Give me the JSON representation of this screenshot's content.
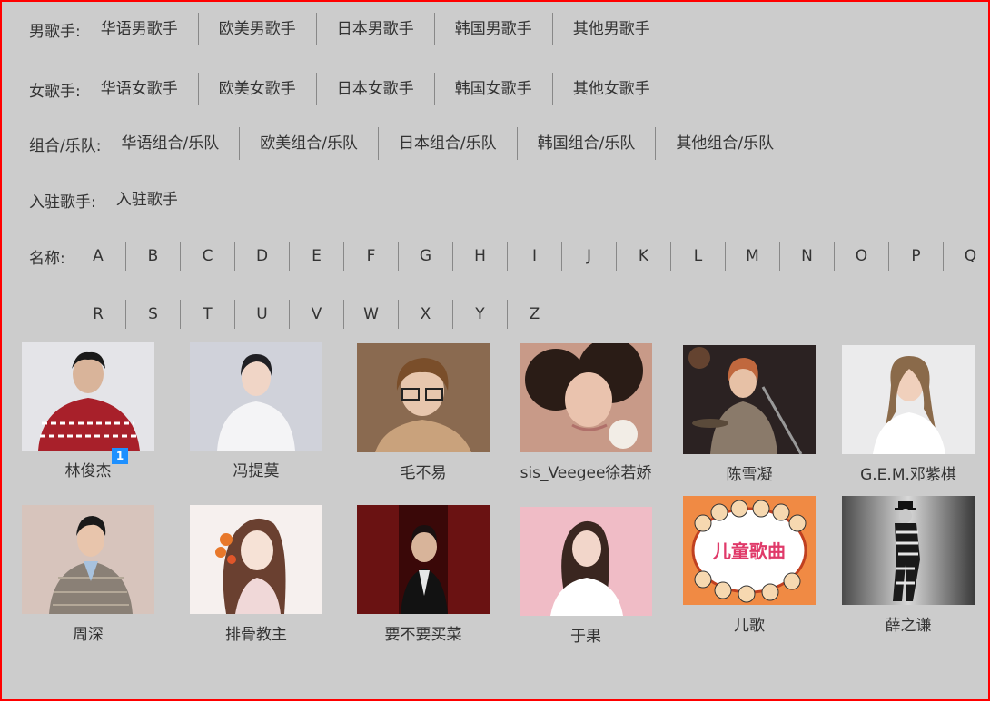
{
  "categories": [
    {
      "label": "男歌手:",
      "items": [
        "华语男歌手",
        "欧美男歌手",
        "日本男歌手",
        "韩国男歌手",
        "其他男歌手"
      ]
    },
    {
      "label": "女歌手:",
      "items": [
        "华语女歌手",
        "欧美女歌手",
        "日本女歌手",
        "韩国女歌手",
        "其他女歌手"
      ]
    },
    {
      "label": "组合/乐队:",
      "items": [
        "华语组合/乐队",
        "欧美组合/乐队",
        "日本组合/乐队",
        "韩国组合/乐队",
        "其他组合/乐队"
      ]
    },
    {
      "label": "入驻歌手:",
      "items": [
        "入驻歌手"
      ]
    }
  ],
  "letters_label": "名称:",
  "letters_row1": [
    "A",
    "B",
    "C",
    "D",
    "E",
    "F",
    "G",
    "H",
    "I",
    "J",
    "K",
    "L",
    "M",
    "N",
    "O",
    "P",
    "Q"
  ],
  "letters_row2": [
    "R",
    "S",
    "T",
    "U",
    "V",
    "W",
    "X",
    "Y",
    "Z"
  ],
  "artists": [
    {
      "name": "林俊杰",
      "badge": "1"
    },
    {
      "name": "冯提莫"
    },
    {
      "name": "毛不易"
    },
    {
      "name": "sis_Veegee徐若娇"
    },
    {
      "name": "陈雪凝"
    },
    {
      "name": "G.E.M.邓紫棋"
    },
    {
      "name": "周深"
    },
    {
      "name": "排骨教主"
    },
    {
      "name": "要不要买菜"
    },
    {
      "name": "于果"
    },
    {
      "name": "儿歌",
      "photo_text": "儿童歌曲"
    },
    {
      "name": "薛之谦"
    }
  ]
}
